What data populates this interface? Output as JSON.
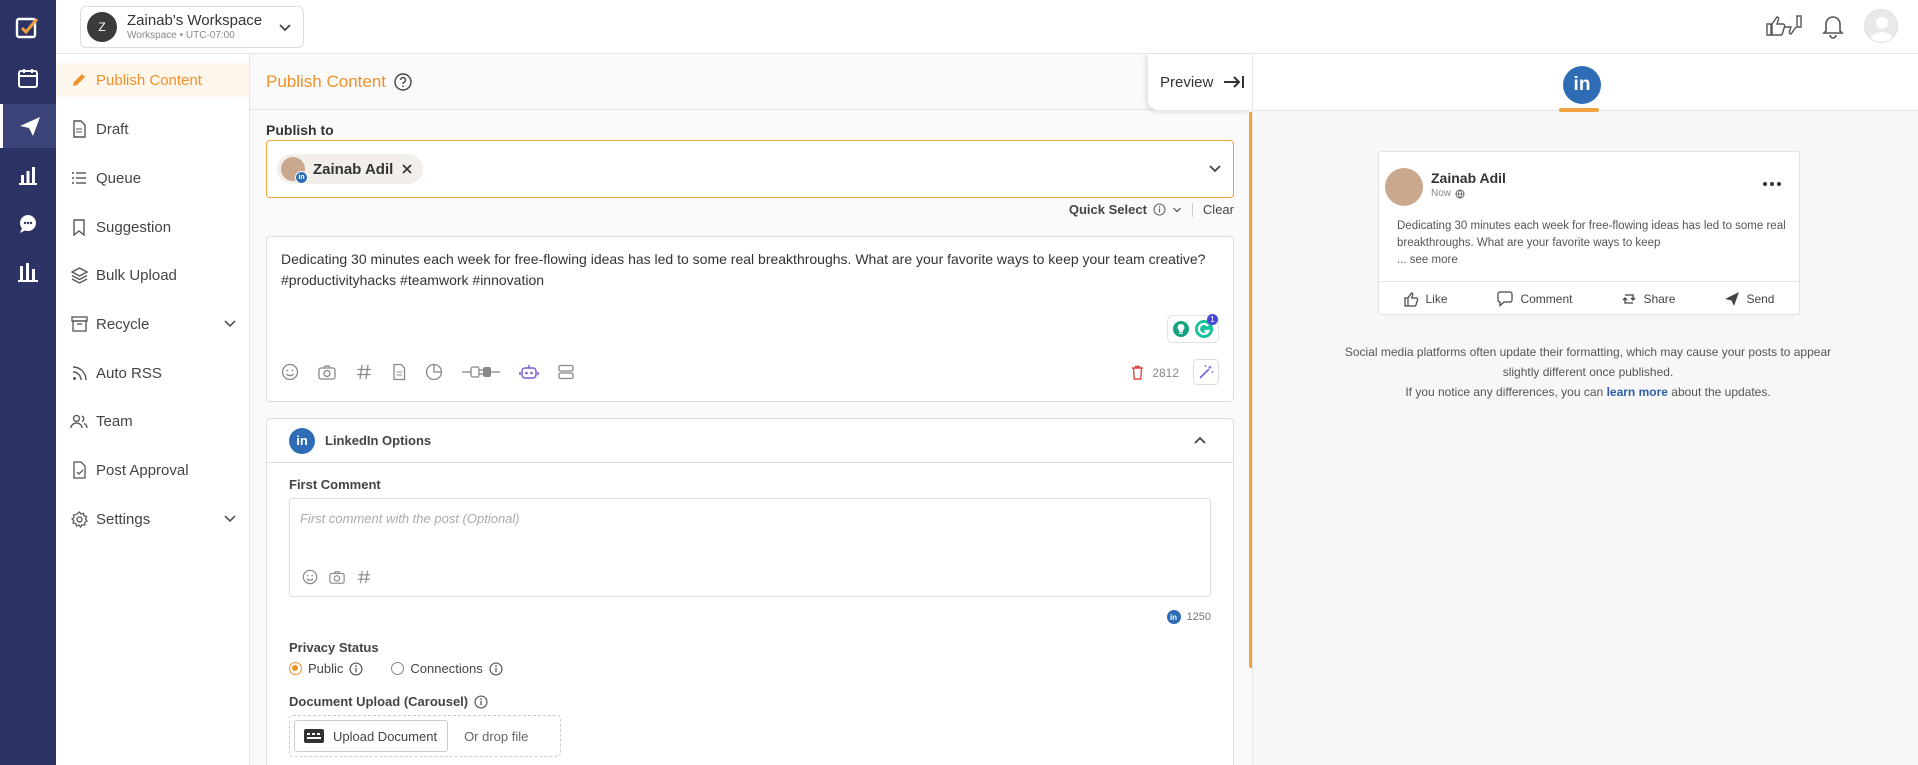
{
  "workspace": {
    "avatar_letter": "Z",
    "name": "Zainab's Workspace",
    "subtitle": "Workspace • UTC-07:00"
  },
  "menu": {
    "items": [
      {
        "label": "Publish Content",
        "icon": "pencil-icon"
      },
      {
        "label": "Draft",
        "icon": "document-icon"
      },
      {
        "label": "Queue",
        "icon": "list-icon"
      },
      {
        "label": "Suggestion",
        "icon": "bookmark-icon"
      },
      {
        "label": "Bulk Upload",
        "icon": "layers-icon"
      },
      {
        "label": "Recycle",
        "icon": "archive-icon"
      },
      {
        "label": "Auto RSS",
        "icon": "rss-icon"
      },
      {
        "label": "Team",
        "icon": "team-icon"
      },
      {
        "label": "Post Approval",
        "icon": "approval-icon"
      },
      {
        "label": "Settings",
        "icon": "gear-icon"
      }
    ]
  },
  "main": {
    "title": "Publish Content",
    "preview_label": "Preview",
    "publish_to_label": "Publish to",
    "selected_account": "Zainab Adil",
    "quick_select": "Quick Select",
    "clear": "Clear",
    "post_text": "Dedicating 30 minutes each week for free-flowing ideas has led to some real breakthroughs.  What are your favorite ways to keep your team creative? #productivityhacks #teamwork #innovation",
    "char_count": "2812",
    "badge_count": "1",
    "linkedin_options": "LinkedIn Options",
    "first_comment_label": "First Comment",
    "first_comment_placeholder": "First comment with the post (Optional)",
    "comment_count": "1250",
    "privacy_label": "Privacy Status",
    "privacy_public": "Public",
    "privacy_connections": "Connections",
    "doc_upload_label": "Document Upload (Carousel)",
    "upload_button": "Upload Document",
    "drop_text": "Or drop file"
  },
  "preview": {
    "name": "Zainab Adil",
    "time": "Now",
    "text": "Dedicating 30 minutes each week for free-flowing ideas has led to some real breakthroughs. What are your favorite ways to keep",
    "see_more": "... see more",
    "actions": [
      "Like",
      "Comment",
      "Share",
      "Send"
    ],
    "note_line1": "Social media platforms often update their formatting, which may cause your posts to appear slightly different once published.",
    "note_line2_pre": "If you notice any differences, you can",
    "note_link": "learn more",
    "note_line2_post": "about the updates."
  },
  "colors": {
    "accent": "#f0902a",
    "rail": "#2b3465",
    "linkedin": "#2e6cb5"
  }
}
